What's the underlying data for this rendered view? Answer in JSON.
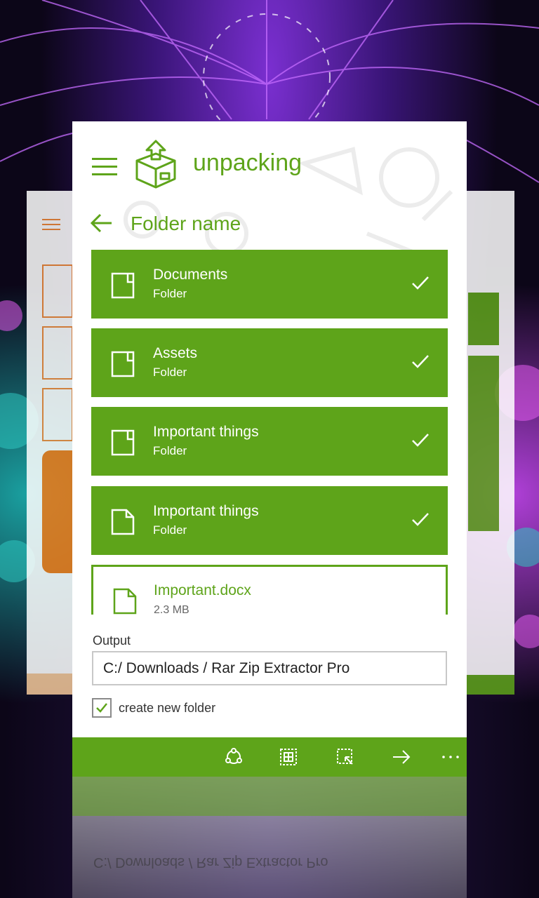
{
  "app": {
    "brand": "unpacking"
  },
  "header": {
    "menu_icon": "hamburger-icon",
    "logo_icon": "package-logo-icon"
  },
  "page": {
    "title": "Folder name",
    "back_icon": "back-arrow-icon"
  },
  "items": [
    {
      "name": "Documents",
      "type": "Folder",
      "icon": "folder-icon",
      "selected": true
    },
    {
      "name": "Assets",
      "type": "Folder",
      "icon": "folder-icon",
      "selected": true
    },
    {
      "name": "Important things",
      "type": "Folder",
      "icon": "folder-icon",
      "selected": true
    },
    {
      "name": "Important things",
      "type": "Folder",
      "icon": "document-icon",
      "selected": true
    },
    {
      "name": "Important.docx",
      "type": "2.3 MB",
      "icon": "document-icon",
      "selected": false
    }
  ],
  "output": {
    "label": "Output",
    "path": "C:/ Downloads / Rar Zip Extractor Pro"
  },
  "options": {
    "create_folder_label": "create new folder",
    "create_folder_checked": true
  },
  "appbar": {
    "icons": [
      "share-icon",
      "select-all-icon",
      "select-items-icon",
      "extract-arrow-icon",
      "more-icon"
    ]
  },
  "colors": {
    "accent": "#5ea41a",
    "secondary_accent": "#f07b17"
  }
}
